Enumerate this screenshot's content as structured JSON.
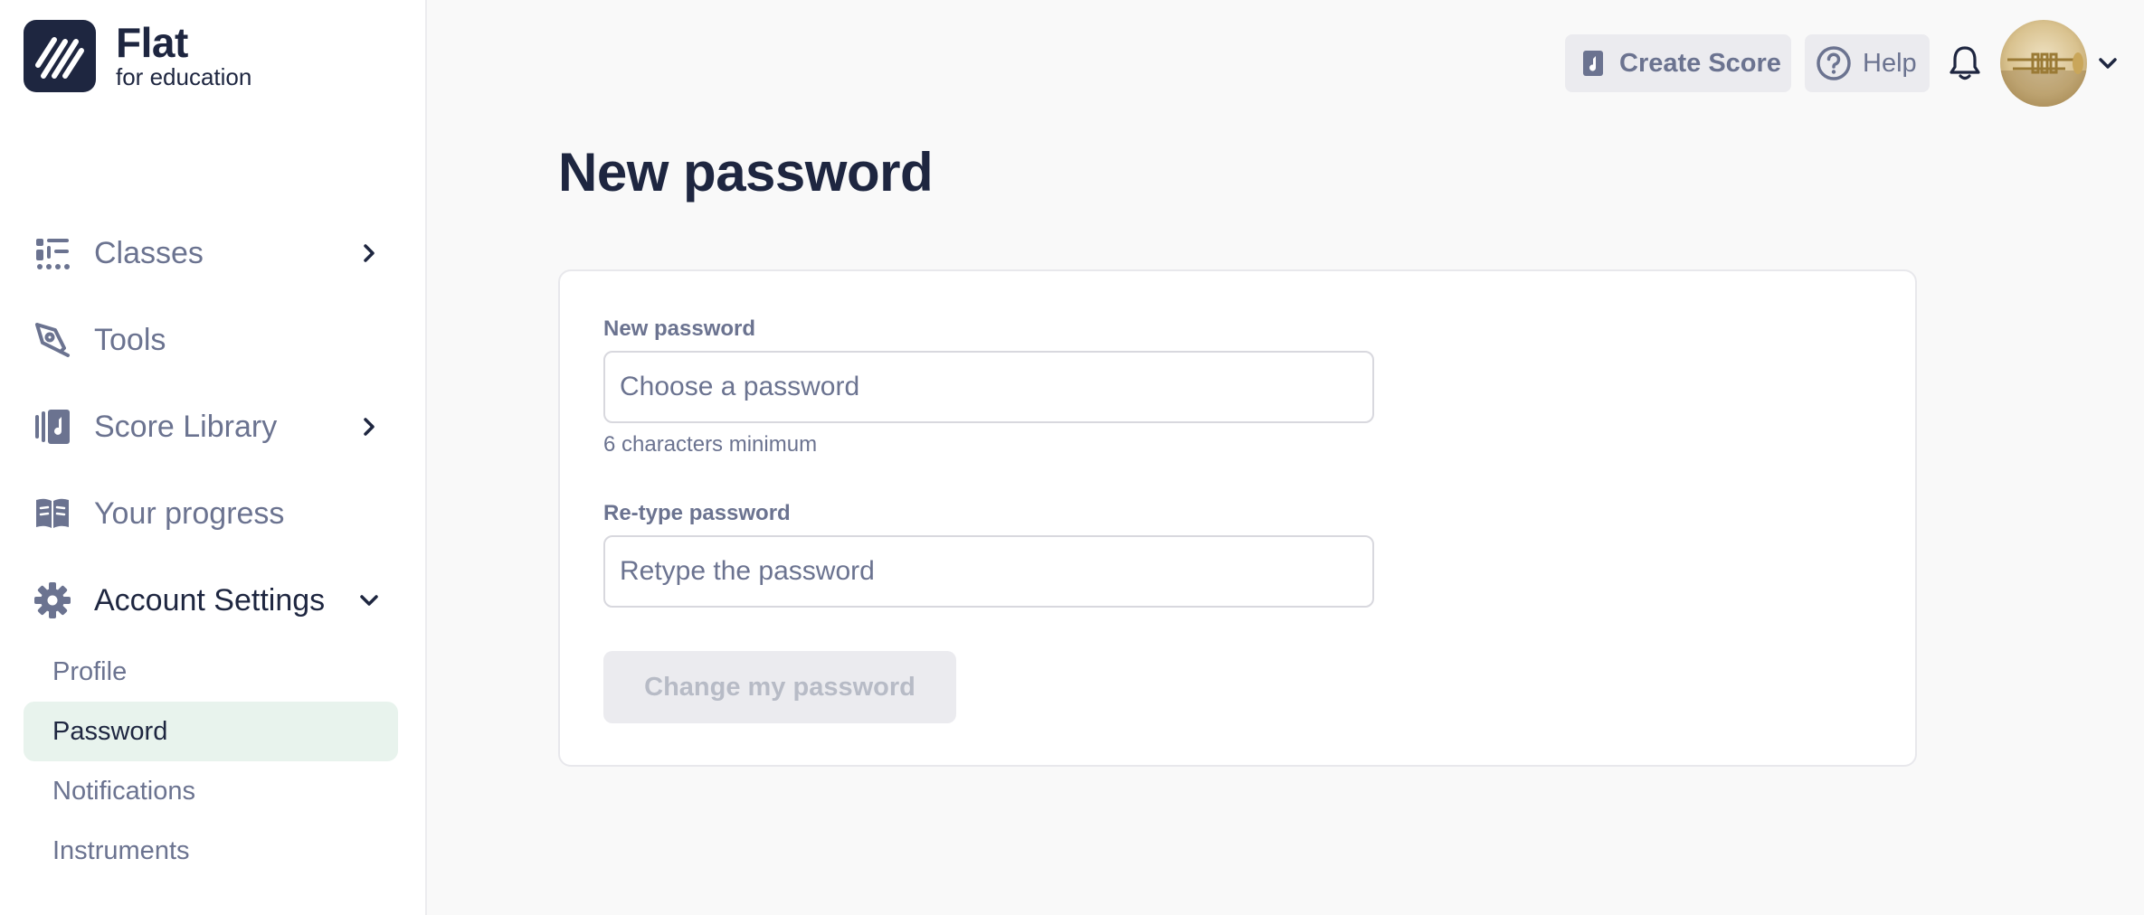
{
  "brand": {
    "name": "Flat",
    "subtitle": "for education"
  },
  "sidebar": {
    "items": [
      {
        "label": "Classes",
        "icon": "classes-icon",
        "has_chevron": true
      },
      {
        "label": "Tools",
        "icon": "tools-pen-icon",
        "has_chevron": false
      },
      {
        "label": "Score Library",
        "icon": "score-library-icon",
        "has_chevron": true
      },
      {
        "label": "Your progress",
        "icon": "book-icon",
        "has_chevron": false
      },
      {
        "label": "Account Settings",
        "icon": "gear-icon",
        "has_chevron": true,
        "expanded": true
      }
    ],
    "subitems": [
      {
        "label": "Profile"
      },
      {
        "label": "Password",
        "selected": true
      },
      {
        "label": "Notifications"
      },
      {
        "label": "Instruments"
      }
    ]
  },
  "topbar": {
    "create_score": "Create Score",
    "help": "Help"
  },
  "page": {
    "title": "New password",
    "new_password_label": "New password",
    "new_password_placeholder": "Choose a password",
    "new_password_hint": "6 characters minimum",
    "retype_label": "Re-type password",
    "retype_placeholder": "Retype the password",
    "submit": "Change my password"
  },
  "colors": {
    "brand_navy": "#1e2640",
    "muted_text": "#6b7390",
    "selected_bg": "#e8f3ed",
    "page_bg": "#f9f9f9"
  }
}
